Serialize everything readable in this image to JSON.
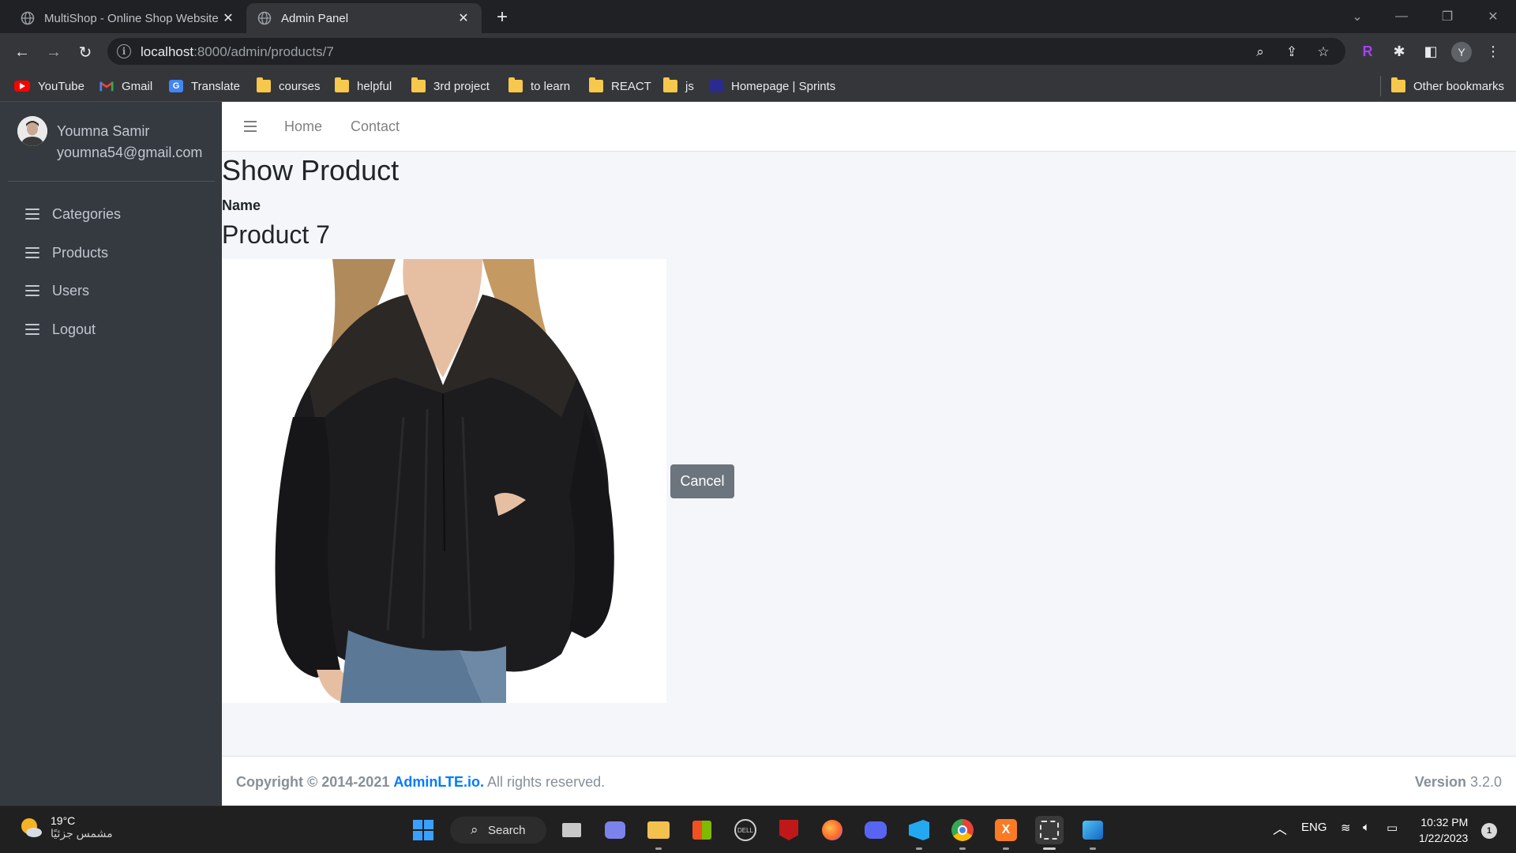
{
  "browser": {
    "tabs": [
      {
        "title": "MultiShop - Online Shop Website",
        "active": false
      },
      {
        "title": "Admin Panel",
        "active": true
      }
    ],
    "url_host": "localhost",
    "url_path": ":8000/admin/products/7",
    "profile_initial": "Y",
    "bookmarks": [
      {
        "label": "YouTube",
        "icon": "youtube-icon"
      },
      {
        "label": "Gmail",
        "icon": "gmail-icon"
      },
      {
        "label": "Translate",
        "icon": "translate-icon"
      },
      {
        "label": "courses",
        "icon": "folder-icon"
      },
      {
        "label": "helpful",
        "icon": "folder-icon"
      },
      {
        "label": "3rd project",
        "icon": "folder-icon"
      },
      {
        "label": "to learn",
        "icon": "folder-icon"
      },
      {
        "label": "REACT",
        "icon": "folder-icon"
      },
      {
        "label": "js",
        "icon": "folder-icon"
      },
      {
        "label": "Homepage | Sprints",
        "icon": "sprints-icon"
      }
    ],
    "other_bookmarks": "Other bookmarks"
  },
  "sidebar": {
    "user": {
      "name": "Youmna Samir",
      "email": "youmna54@gmail.com"
    },
    "items": [
      {
        "label": "Categories"
      },
      {
        "label": "Products"
      },
      {
        "label": "Users"
      },
      {
        "label": "Logout"
      }
    ]
  },
  "topnav": {
    "links": [
      {
        "label": "Home"
      },
      {
        "label": "Contact"
      }
    ]
  },
  "content": {
    "title": "Show Product",
    "name_label": "Name",
    "product_name": "Product 7",
    "cancel_label": "Cancel"
  },
  "footer": {
    "copyright_prefix": "Copyright © 2014-2021",
    "link_text": "AdminLTE.io.",
    "suffix": "All rights reserved.",
    "version_label": "Version",
    "version_value": "3.2.0"
  },
  "taskbar": {
    "weather_temp": "19°C",
    "weather_desc": "مشمس جزئيًا",
    "search_label": "Search",
    "language": "ENG",
    "time": "10:32 PM",
    "date": "1/22/2023",
    "notifications": "1"
  },
  "colors": {
    "sidebar_bg": "#343a40",
    "content_bg": "#f4f6f9",
    "cancel_button": "#6c757d",
    "footer_link": "#007bff"
  }
}
